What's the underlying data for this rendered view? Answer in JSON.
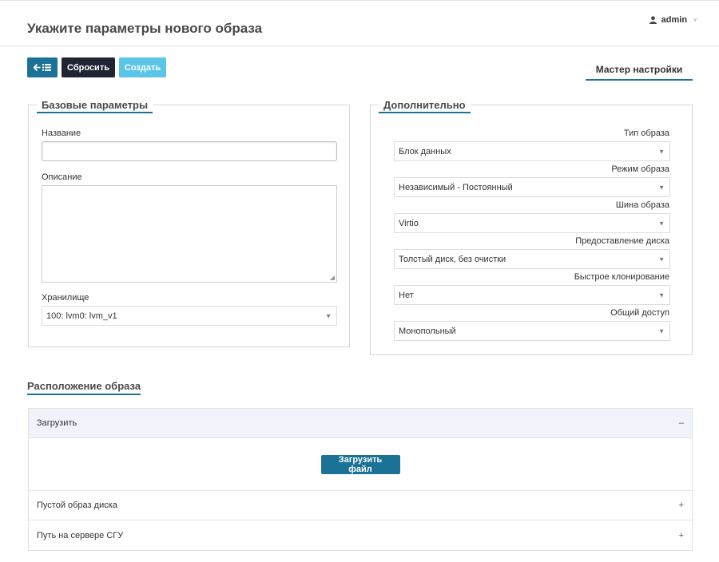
{
  "header": {
    "title": "Укажите параметры нового образа",
    "user": "admin"
  },
  "toolbar": {
    "back_icon": "arrow-left-list-icon",
    "reset_label": "Сбросить",
    "create_label": "Создать"
  },
  "wizard_tab": "Мастер настройки",
  "basic": {
    "legend": "Базовые параметры",
    "name_label": "Название",
    "name_value": "",
    "description_label": "Описание",
    "description_value": "",
    "storage_label": "Хранилище",
    "storage_value": "100: lvm0: lvm_v1"
  },
  "advanced": {
    "legend": "Дополнительно",
    "fields": [
      {
        "label": "Тип образа",
        "value": "Блок данных"
      },
      {
        "label": "Режим образа",
        "value": "Независимый - Постоянный"
      },
      {
        "label": "Шина образа",
        "value": "Virtio"
      },
      {
        "label": "Предоставление диска",
        "value": "Толстый диск, без очистки"
      },
      {
        "label": "Быстрое клонирование",
        "value": "Нет"
      },
      {
        "label": "Общий доступ",
        "value": "Монопольный"
      }
    ]
  },
  "location": {
    "title": "Расположение образа",
    "sections": [
      {
        "label": "Загрузить",
        "toggle": "–",
        "expanded": true
      },
      {
        "label": "Пустой образ диска",
        "toggle": "+",
        "expanded": false
      },
      {
        "label": "Путь на сервере СГУ",
        "toggle": "+",
        "expanded": false
      }
    ],
    "upload_button": "Загрузить файл"
  },
  "colors": {
    "accent": "#1a7396",
    "dark_button": "#1f2533",
    "light_button": "#5bc5e8"
  }
}
